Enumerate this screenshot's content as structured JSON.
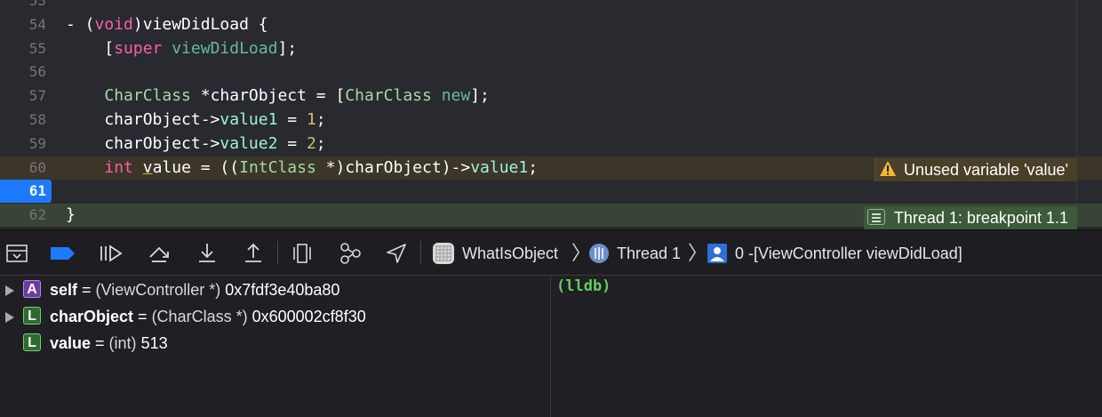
{
  "editor": {
    "lines": [
      {
        "num": "53",
        "segments": []
      },
      {
        "num": "54",
        "segments": [
          {
            "t": "- (",
            "c": "pl"
          },
          {
            "t": "void",
            "c": "kw"
          },
          {
            "t": ")viewDidLoad {",
            "c": "pl"
          }
        ]
      },
      {
        "num": "55",
        "segments": [
          {
            "t": "    [",
            "c": "pl"
          },
          {
            "t": "super",
            "c": "kw"
          },
          {
            "t": " ",
            "c": "pl"
          },
          {
            "t": "viewDidLoad",
            "c": "fn"
          },
          {
            "t": "];",
            "c": "pl"
          }
        ]
      },
      {
        "num": "56",
        "segments": []
      },
      {
        "num": "57",
        "segments": [
          {
            "t": "    ",
            "c": "pl"
          },
          {
            "t": "CharClass",
            "c": "cls"
          },
          {
            "t": " *charObject = [",
            "c": "pl"
          },
          {
            "t": "CharClass",
            "c": "cls"
          },
          {
            "t": " ",
            "c": "pl"
          },
          {
            "t": "new",
            "c": "fn"
          },
          {
            "t": "];",
            "c": "pl"
          }
        ]
      },
      {
        "num": "58",
        "segments": [
          {
            "t": "    charObject->",
            "c": "pl"
          },
          {
            "t": "value1",
            "c": "prop"
          },
          {
            "t": " = ",
            "c": "pl"
          },
          {
            "t": "1",
            "c": "num-lit"
          },
          {
            "t": ";",
            "c": "pl"
          }
        ]
      },
      {
        "num": "59",
        "segments": [
          {
            "t": "    charObject->",
            "c": "pl"
          },
          {
            "t": "value2",
            "c": "prop"
          },
          {
            "t": " = ",
            "c": "pl"
          },
          {
            "t": "2",
            "c": "num-lit"
          },
          {
            "t": ";",
            "c": "pl"
          }
        ]
      },
      {
        "num": "60",
        "segments": [
          {
            "t": "    ",
            "c": "pl"
          },
          {
            "t": "int",
            "c": "kw"
          },
          {
            "t": " ",
            "c": "pl"
          },
          {
            "t": "v",
            "c": "pl ul"
          },
          {
            "t": "alue = ((",
            "c": "pl"
          },
          {
            "t": "IntClass",
            "c": "cls"
          },
          {
            "t": " *)charObject)->",
            "c": "pl"
          },
          {
            "t": "value1",
            "c": "prop"
          },
          {
            "t": ";",
            "c": "pl"
          }
        ]
      },
      {
        "num": "61",
        "segments": []
      },
      {
        "num": "62",
        "segments": [
          {
            "t": "}",
            "c": "pl"
          }
        ]
      }
    ],
    "warning_text": "Unused variable 'value'",
    "breakpoint_text": "Thread 1: breakpoint 1.1"
  },
  "debugbar": {
    "app": "WhatIsObject",
    "thread": "Thread 1",
    "frame": "0 -[ViewController viewDidLoad]"
  },
  "variables": [
    {
      "kind": "A",
      "expandable": true,
      "name": "self",
      "type": "(ViewController *)",
      "value": "0x7fdf3e40ba80"
    },
    {
      "kind": "L",
      "expandable": true,
      "name": "charObject",
      "type": "(CharClass *)",
      "value": "0x600002cf8f30"
    },
    {
      "kind": "L",
      "expandable": false,
      "name": "value",
      "type": "(int)",
      "value": "513"
    }
  ],
  "console": {
    "prompt": "(lldb)"
  },
  "colors": {
    "breakpoint_blue": "#1d7afc",
    "warning_row": "#3b3629",
    "current_line": "#384536",
    "lldb_green": "#5fcf5f"
  }
}
